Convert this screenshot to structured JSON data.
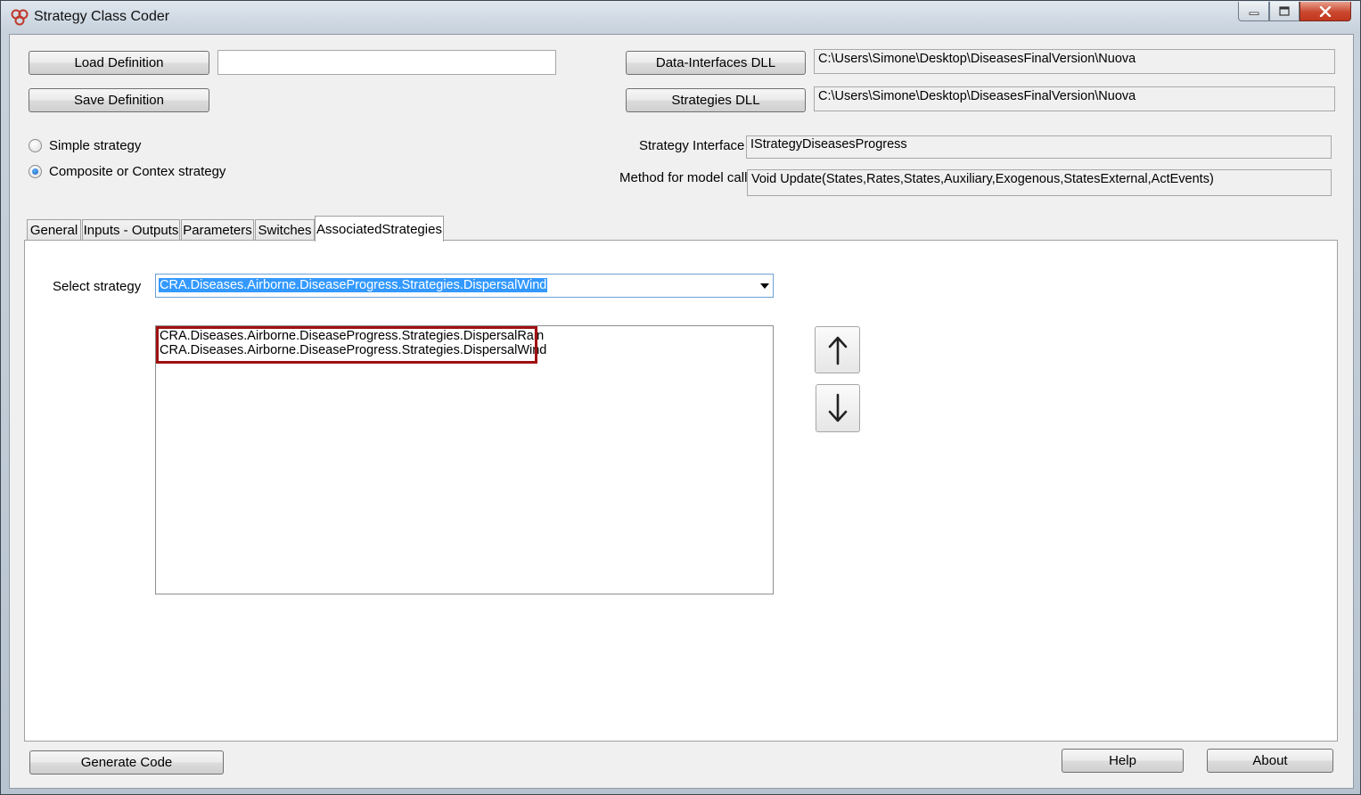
{
  "window": {
    "title": "Strategy Class Coder"
  },
  "top": {
    "load_definition": "Load Definition",
    "save_definition": "Save Definition",
    "definition_path": "",
    "data_interfaces_dll_button": "Data-Interfaces DLL",
    "data_interfaces_dll_path": "C:\\Users\\Simone\\Desktop\\DiseasesFinalVersion\\Nuova",
    "strategies_dll_button": "Strategies DLL",
    "strategies_dll_path": "C:\\Users\\Simone\\Desktop\\DiseasesFinalVersion\\Nuova"
  },
  "strategy_type": {
    "options": [
      {
        "label": "Simple strategy",
        "checked": false
      },
      {
        "label": "Composite or Contex strategy",
        "checked": true
      }
    ]
  },
  "interface": {
    "strategy_interface_label": "Strategy Interface",
    "strategy_interface_value": "IStrategyDiseasesProgress",
    "method_label": "Method for model call",
    "method_value": "Void Update(States,Rates,States,Auxiliary,Exogenous,StatesExternal,ActEvents)"
  },
  "tabs": [
    {
      "label": "General",
      "active": false
    },
    {
      "label": "Inputs - Outputs",
      "active": false
    },
    {
      "label": "Parameters",
      "active": false
    },
    {
      "label": "Switches",
      "active": false
    },
    {
      "label": "AssociatedStrategies",
      "active": true
    }
  ],
  "associated": {
    "select_label": "Select strategy",
    "selected_strategy": "CRA.Diseases.Airborne.DiseaseProgress.Strategies.DispersalWind",
    "list_items": [
      "CRA.Diseases.Airborne.DiseaseProgress.Strategies.DispersalRain",
      "CRA.Diseases.Airborne.DiseaseProgress.Strategies.DispersalWind"
    ],
    "highlight_color": "#a01010"
  },
  "bottom": {
    "generate_code": "Generate Code",
    "help": "Help",
    "about": "About"
  },
  "icons": {
    "move_up": "arrow-up-icon",
    "move_down": "arrow-down-icon",
    "app": "app-icon"
  }
}
